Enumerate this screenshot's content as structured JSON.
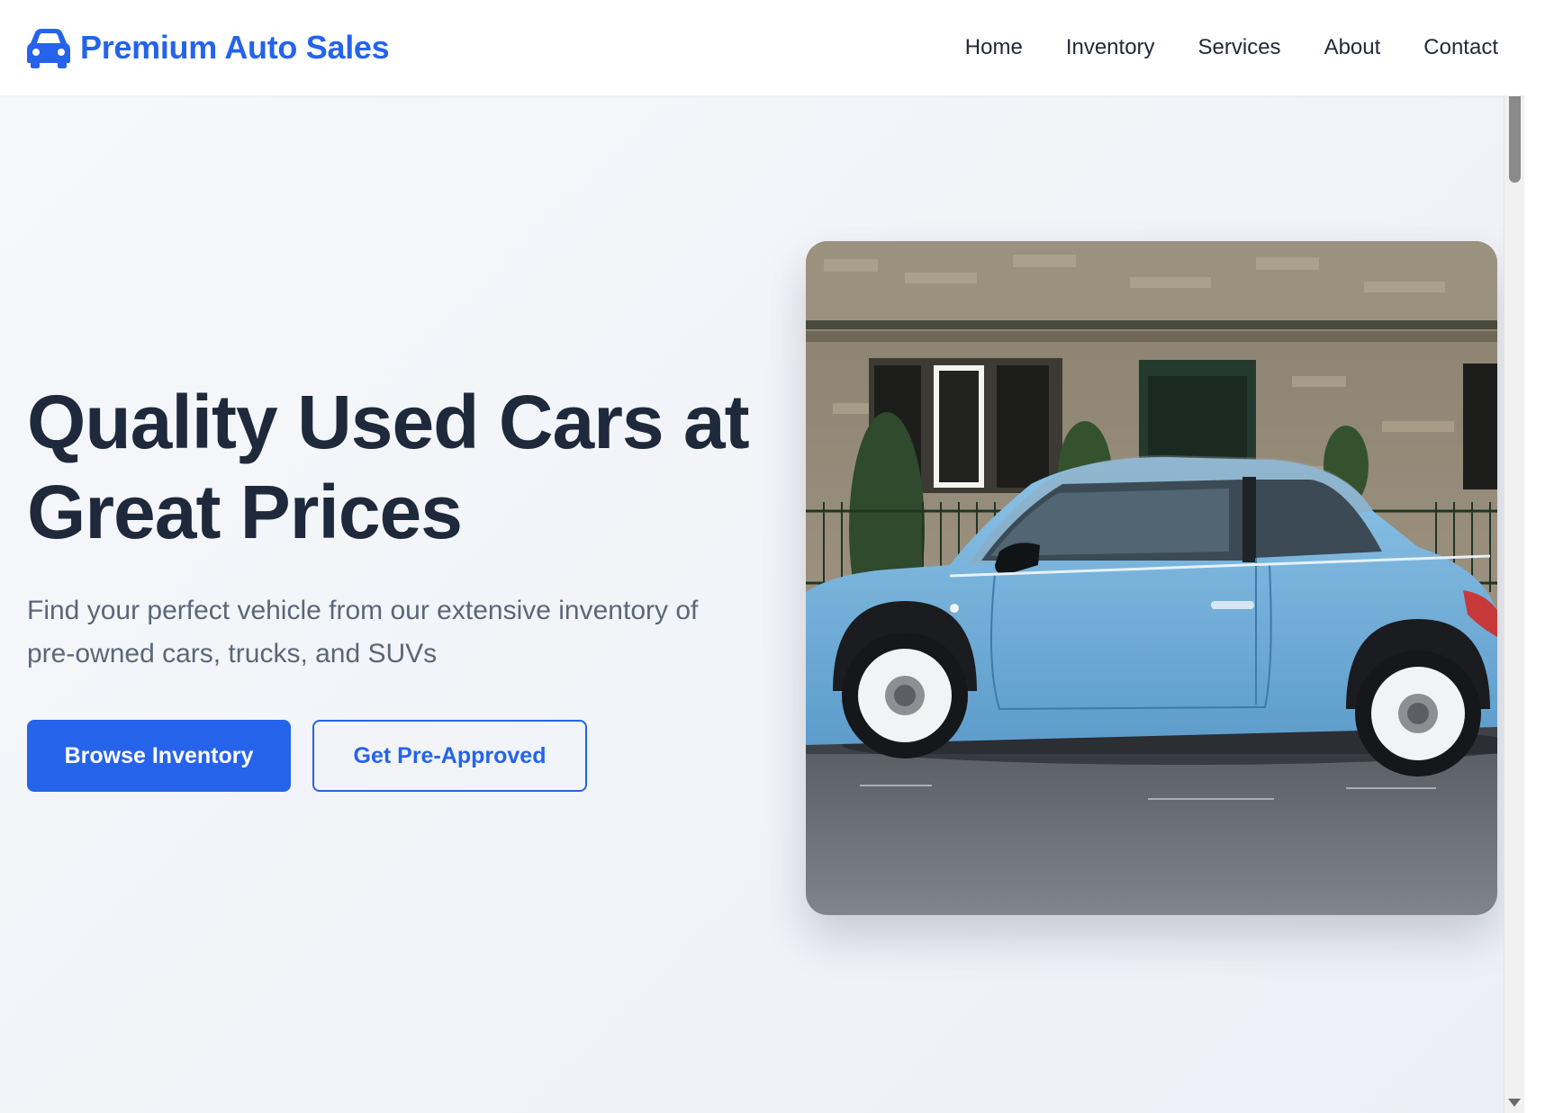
{
  "brand": {
    "name": "Premium Auto Sales",
    "icon": "car-icon",
    "color": "#2563eb"
  },
  "nav": {
    "items": [
      {
        "label": "Home"
      },
      {
        "label": "Inventory"
      },
      {
        "label": "Services"
      },
      {
        "label": "About"
      },
      {
        "label": "Contact"
      }
    ]
  },
  "hero": {
    "title": "Quality Used Cars at Great Prices",
    "subtitle": "Find your perfect vehicle from our extensive inventory of pre-owned cars, trucks, and SUVs",
    "primary_button": "Browse Inventory",
    "secondary_button": "Get Pre-Approved",
    "image": "photo of a light blue compact hatchback parked in front of an old stone building"
  },
  "colors": {
    "accent": "#2563eb",
    "heading": "#1e293b",
    "body_text": "#5b6778"
  }
}
